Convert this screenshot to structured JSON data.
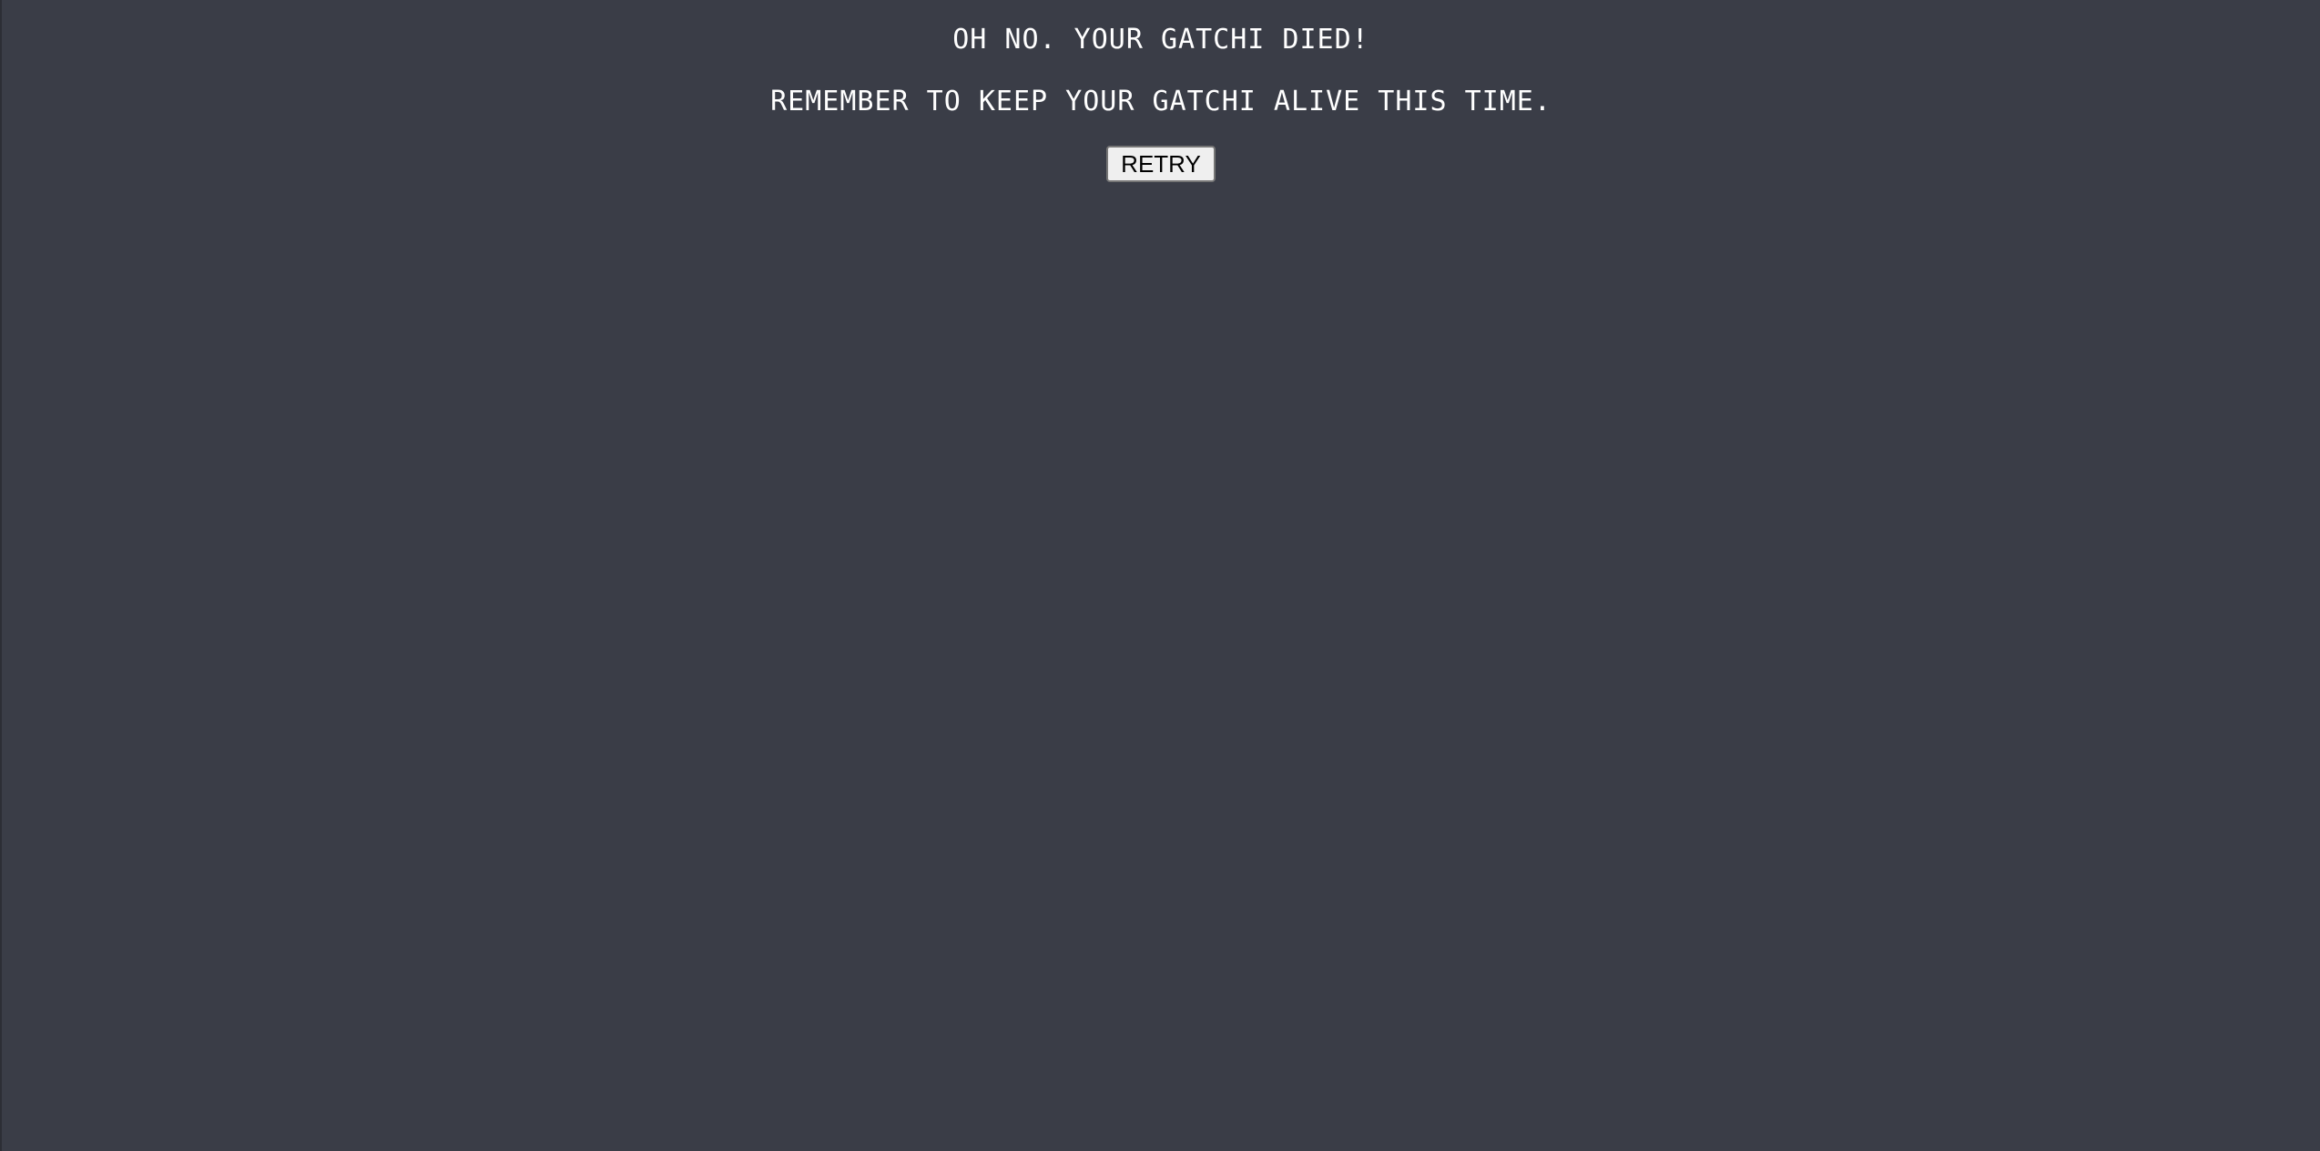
{
  "game_over": {
    "headline": "OH NO. YOUR GATCHI DIED!",
    "reminder": "REMEMBER TO KEEP YOUR GATCHI ALIVE THIS TIME.",
    "retry_label": "RETRY"
  },
  "colors": {
    "background": "#3a3d47",
    "text": "#ffffff",
    "button_bg": "#efefef",
    "button_text": "#000000"
  }
}
